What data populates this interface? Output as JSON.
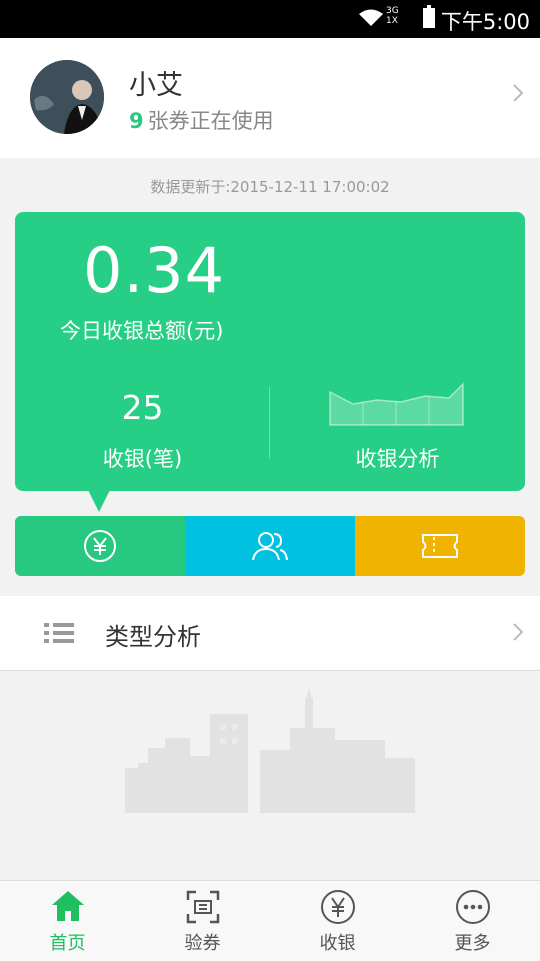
{
  "status_bar": {
    "time": "下午5:00",
    "network": [
      "3G",
      "1X"
    ]
  },
  "profile": {
    "name": "小艾",
    "coupon_count": "9",
    "coupon_text": "张券正在使用"
  },
  "updated_text": "数据更新于:2015-12-11 17:00:02",
  "summary": {
    "amount": "0.34",
    "amount_label": "今日收银总额(元)",
    "count": "25",
    "count_label": "收银(笔)",
    "analysis_label": "收银分析"
  },
  "quick_tabs": [
    {
      "icon": "yen-circle-icon",
      "color": "#26c97f"
    },
    {
      "icon": "users-icon",
      "color": "#00c2e0"
    },
    {
      "icon": "ticket-icon",
      "color": "#f0b400"
    }
  ],
  "type_analysis": {
    "label": "类型分析"
  },
  "bottom_nav": [
    {
      "label": "首页",
      "icon": "home-icon",
      "active": true
    },
    {
      "label": "验券",
      "icon": "scan-icon",
      "active": false
    },
    {
      "label": "收银",
      "icon": "yen-circle-icon",
      "active": false
    },
    {
      "label": "更多",
      "icon": "more-icon",
      "active": false
    }
  ],
  "colors": {
    "accent": "#26ce86",
    "cyan": "#00c2e0",
    "amber": "#f0b400"
  }
}
